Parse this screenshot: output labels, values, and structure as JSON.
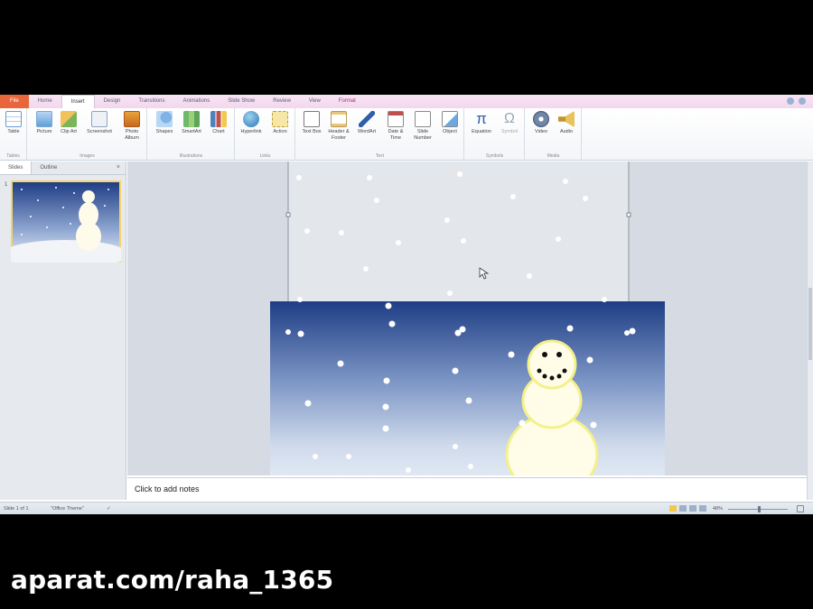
{
  "ribbon": {
    "tabs": [
      "File",
      "Home",
      "Insert",
      "Design",
      "Transitions",
      "Animations",
      "Slide Show",
      "Review",
      "View",
      "Format"
    ],
    "groups": {
      "tables": {
        "label": "Tables",
        "buttons": [
          "Table"
        ]
      },
      "images": {
        "label": "Images",
        "buttons": [
          "Picture",
          "Clip Art",
          "Screenshot",
          "Photo Album"
        ]
      },
      "illustrations": {
        "label": "Illustrations",
        "buttons": [
          "Shapes",
          "SmartArt",
          "Chart"
        ]
      },
      "links": {
        "label": "Links",
        "buttons": [
          "Hyperlink",
          "Action"
        ]
      },
      "text": {
        "label": "Text",
        "buttons": [
          "Text Box",
          "Header & Footer",
          "WordArt",
          "Date & Time",
          "Slide Number",
          "Object"
        ]
      },
      "symbols": {
        "label": "Symbols",
        "buttons": [
          "Equation",
          "Symbol"
        ]
      },
      "media": {
        "label": "Media",
        "buttons": [
          "Video",
          "Audio"
        ]
      }
    }
  },
  "panel": {
    "tabs": [
      "Slides",
      "Outline"
    ],
    "close": "×",
    "slide_number": "1"
  },
  "notes": {
    "placeholder": "Click to add notes"
  },
  "status": {
    "slide": "Slide 1 of 1",
    "theme": "\"Office Theme\"",
    "zoom": "48%"
  },
  "watermark": "aparat.com/raha_1365",
  "colors": {
    "file_tab": "#e9653b",
    "sky_top": "#1f3d85",
    "sky_bottom": "#dfe8f5",
    "snowman_glow": "#f4f08a"
  }
}
